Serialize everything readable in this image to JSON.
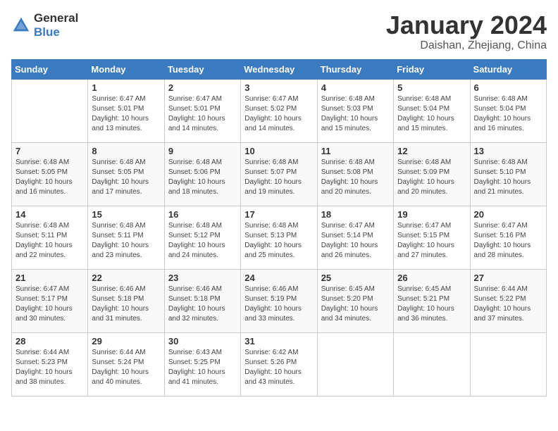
{
  "header": {
    "logo_general": "General",
    "logo_blue": "Blue",
    "title": "January 2024",
    "subtitle": "Daishan, Zhejiang, China"
  },
  "days_of_week": [
    "Sunday",
    "Monday",
    "Tuesday",
    "Wednesday",
    "Thursday",
    "Friday",
    "Saturday"
  ],
  "weeks": [
    [
      {
        "num": "",
        "info": ""
      },
      {
        "num": "1",
        "info": "Sunrise: 6:47 AM\nSunset: 5:01 PM\nDaylight: 10 hours\nand 13 minutes."
      },
      {
        "num": "2",
        "info": "Sunrise: 6:47 AM\nSunset: 5:01 PM\nDaylight: 10 hours\nand 14 minutes."
      },
      {
        "num": "3",
        "info": "Sunrise: 6:47 AM\nSunset: 5:02 PM\nDaylight: 10 hours\nand 14 minutes."
      },
      {
        "num": "4",
        "info": "Sunrise: 6:48 AM\nSunset: 5:03 PM\nDaylight: 10 hours\nand 15 minutes."
      },
      {
        "num": "5",
        "info": "Sunrise: 6:48 AM\nSunset: 5:04 PM\nDaylight: 10 hours\nand 15 minutes."
      },
      {
        "num": "6",
        "info": "Sunrise: 6:48 AM\nSunset: 5:04 PM\nDaylight: 10 hours\nand 16 minutes."
      }
    ],
    [
      {
        "num": "7",
        "info": ""
      },
      {
        "num": "8",
        "info": "Sunrise: 6:48 AM\nSunset: 5:05 PM\nDaylight: 10 hours\nand 17 minutes."
      },
      {
        "num": "9",
        "info": "Sunrise: 6:48 AM\nSunset: 5:06 PM\nDaylight: 10 hours\nand 18 minutes."
      },
      {
        "num": "10",
        "info": "Sunrise: 6:48 AM\nSunset: 5:07 PM\nDaylight: 10 hours\nand 19 minutes."
      },
      {
        "num": "11",
        "info": "Sunrise: 6:48 AM\nSunset: 5:08 PM\nDaylight: 10 hours\nand 20 minutes."
      },
      {
        "num": "12",
        "info": "Sunrise: 6:48 AM\nSunset: 5:09 PM\nDaylight: 10 hours\nand 20 minutes."
      },
      {
        "num": "13",
        "info": "Sunrise: 6:48 AM\nSunset: 5:10 PM\nDaylight: 10 hours\nand 21 minutes."
      }
    ],
    [
      {
        "num": "14",
        "info": ""
      },
      {
        "num": "15",
        "info": "Sunrise: 6:48 AM\nSunset: 5:11 PM\nDaylight: 10 hours\nand 23 minutes."
      },
      {
        "num": "16",
        "info": "Sunrise: 6:48 AM\nSunset: 5:12 PM\nDaylight: 10 hours\nand 24 minutes."
      },
      {
        "num": "17",
        "info": "Sunrise: 6:48 AM\nSunset: 5:13 PM\nDaylight: 10 hours\nand 25 minutes."
      },
      {
        "num": "18",
        "info": "Sunrise: 6:47 AM\nSunset: 5:14 PM\nDaylight: 10 hours\nand 26 minutes."
      },
      {
        "num": "19",
        "info": "Sunrise: 6:47 AM\nSunset: 5:15 PM\nDaylight: 10 hours\nand 27 minutes."
      },
      {
        "num": "20",
        "info": "Sunrise: 6:47 AM\nSunset: 5:16 PM\nDaylight: 10 hours\nand 28 minutes."
      }
    ],
    [
      {
        "num": "21",
        "info": ""
      },
      {
        "num": "22",
        "info": "Sunrise: 6:46 AM\nSunset: 5:18 PM\nDaylight: 10 hours\nand 31 minutes."
      },
      {
        "num": "23",
        "info": "Sunrise: 6:46 AM\nSunset: 5:18 PM\nDaylight: 10 hours\nand 32 minutes."
      },
      {
        "num": "24",
        "info": "Sunrise: 6:46 AM\nSunset: 5:19 PM\nDaylight: 10 hours\nand 33 minutes."
      },
      {
        "num": "25",
        "info": "Sunrise: 6:45 AM\nSunset: 5:20 PM\nDaylight: 10 hours\nand 34 minutes."
      },
      {
        "num": "26",
        "info": "Sunrise: 6:45 AM\nSunset: 5:21 PM\nDaylight: 10 hours\nand 36 minutes."
      },
      {
        "num": "27",
        "info": "Sunrise: 6:44 AM\nSunset: 5:22 PM\nDaylight: 10 hours\nand 37 minutes."
      }
    ],
    [
      {
        "num": "28",
        "info": ""
      },
      {
        "num": "29",
        "info": "Sunrise: 6:44 AM\nSunset: 5:24 PM\nDaylight: 10 hours\nand 40 minutes."
      },
      {
        "num": "30",
        "info": "Sunrise: 6:43 AM\nSunset: 5:25 PM\nDaylight: 10 hours\nand 41 minutes."
      },
      {
        "num": "31",
        "info": "Sunrise: 6:42 AM\nSunset: 5:26 PM\nDaylight: 10 hours\nand 43 minutes."
      },
      {
        "num": "",
        "info": ""
      },
      {
        "num": "",
        "info": ""
      },
      {
        "num": "",
        "info": ""
      }
    ]
  ],
  "week1_day14_info": "Sunrise: 6:48 AM\nSunset: 5:11 PM\nDaylight: 10 hours\nand 22 minutes.",
  "week1_day7_info": "Sunrise: 6:48 AM\nSunset: 5:05 PM\nDaylight: 10 hours\nand 16 minutes.",
  "week1_day21_info": "Sunrise: 6:47 AM\nSunset: 5:17 PM\nDaylight: 10 hours\nand 30 minutes.",
  "week1_day28_info": "Sunrise: 6:44 AM\nSunset: 5:23 PM\nDaylight: 10 hours\nand 38 minutes."
}
